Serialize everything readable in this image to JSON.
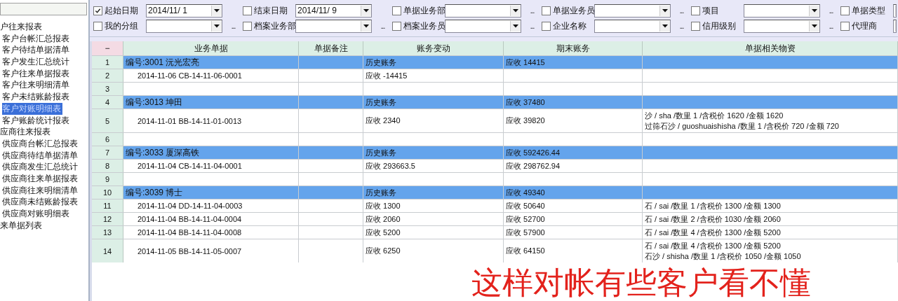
{
  "sidebar": {
    "items": [
      {
        "label": "户往来报表",
        "selected": false,
        "children": [
          {
            "label": "客户台帐汇总报表",
            "selected": false
          },
          {
            "label": "客户待结单据清单",
            "selected": false
          },
          {
            "label": "客户发生汇总统计",
            "selected": false
          },
          {
            "label": "客户往来单据报表",
            "selected": false
          },
          {
            "label": "客户往来明细清单",
            "selected": false
          },
          {
            "label": "客户未结账龄报表",
            "selected": false
          },
          {
            "label": "客户对账明细表",
            "selected": true
          },
          {
            "label": "客户账龄统计报表",
            "selected": false
          }
        ]
      },
      {
        "label": "应商往来报表",
        "selected": false,
        "children": [
          {
            "label": "供应商台帐汇总报表",
            "selected": false
          },
          {
            "label": "供应商待结单据清单",
            "selected": false
          },
          {
            "label": "供应商发生汇总统计",
            "selected": false
          },
          {
            "label": "供应商往来单据报表",
            "selected": false
          },
          {
            "label": "供应商往来明细清单",
            "selected": false
          },
          {
            "label": "供应商未结账龄报表",
            "selected": false
          },
          {
            "label": "供应商对账明细表",
            "selected": false
          }
        ]
      },
      {
        "label": "来单据列表",
        "selected": false
      }
    ]
  },
  "filter_rows": [
    {
      "filters": [
        {
          "label": "起始日期",
          "checked": true,
          "value": "2014/11/ 1"
        },
        {
          "label": "结束日期",
          "checked": false,
          "value": "2014/11/ 9"
        },
        {
          "label": "单据业务部",
          "checked": false,
          "more": "..."
        },
        {
          "label": "单据业务员",
          "checked": false,
          "more": "..."
        },
        {
          "label": "项目",
          "checked": false,
          "more": "..."
        },
        {
          "label": "单据类型",
          "checked": false
        }
      ]
    },
    {
      "filters": [
        {
          "label": "我的分组",
          "checked": false,
          "more": "..."
        },
        {
          "label": "档案业务部",
          "checked": false,
          "more": "..."
        },
        {
          "label": "档案业务员",
          "checked": false,
          "more": "..."
        },
        {
          "label": "企业名称",
          "checked": false,
          "more": "..."
        },
        {
          "label": "信用级别",
          "checked": false,
          "more": "..."
        },
        {
          "label": "代理商",
          "checked": false
        }
      ]
    }
  ],
  "table": {
    "corner": "−",
    "columns": [
      "业务单据",
      "单据备注",
      "账务变动",
      "期末账务",
      "单据相关物资"
    ],
    "rows": [
      {
        "number": "1",
        "kind": "group",
        "document": "编号:3001 沅光宏亮",
        "change": "历史账务",
        "balance": "应收 14415"
      },
      {
        "number": "2",
        "kind": "detail",
        "document": "2014-11-06 CB-14-11-06-0001",
        "change": "应收 -14415"
      },
      {
        "number": "3",
        "kind": "blank"
      },
      {
        "number": "4",
        "kind": "group",
        "document": "编号:3013 坤田",
        "change": "历史账务",
        "balance": "应收 37480"
      },
      {
        "number": "5",
        "kind": "detail",
        "document": "2014-11-01 BB-14-11-01-0013",
        "change": "应收 2340",
        "balance": "应收 39820",
        "materials": [
          "沙 / sha /数里 1 /含税价 1620 /金额 1620",
          "过筛石沙 / guoshuaishisha /数里 1 /含税价 720 /金额 720"
        ]
      },
      {
        "number": "6",
        "kind": "blank"
      },
      {
        "number": "7",
        "kind": "group",
        "document": "编号:3033 厦深高铁",
        "change": "历史账务",
        "balance": "应收 592426.44"
      },
      {
        "number": "8",
        "kind": "detail",
        "document": "2014-11-04 CB-14-11-04-0001",
        "change": "应收 293663.5",
        "balance": "应收 298762.94"
      },
      {
        "number": "9",
        "kind": "blank"
      },
      {
        "number": "10",
        "kind": "group",
        "document": "编号:3039 博士",
        "change": "历史账务",
        "balance": "应收 49340"
      },
      {
        "number": "11",
        "kind": "detail",
        "document": "2014-11-04 DD-14-11-04-0003",
        "change": "应收 1300",
        "balance": "应收 50640",
        "materials": [
          "石 / sai /数里 1 /含税价 1300 /金额 1300"
        ]
      },
      {
        "number": "12",
        "kind": "detail",
        "document": "2014-11-04 BB-14-11-04-0004",
        "change": "应收 2060",
        "balance": "应收 52700",
        "materials": [
          "石 / sai /数里 2 /含税价 1030 /金额 2060"
        ]
      },
      {
        "number": "13",
        "kind": "detail",
        "document": "2014-11-04 BB-14-11-04-0008",
        "change": "应收 5200",
        "balance": "应收 57900",
        "materials": [
          "石 / sai /数里 4 /含税价 1300 /金额 5200"
        ]
      },
      {
        "number": "14",
        "kind": "detail",
        "document": "2014-11-05 BB-14-11-05-0007",
        "change": "应收 6250",
        "balance": "应收 64150",
        "materials": [
          "石 / sai /数里 4 /含税价 1300 /金额 5200",
          "石沙 / shisha /数里 1 /含税价 1050 /金额 1050"
        ]
      }
    ]
  },
  "annotation": "这样对帐有些客户看不懂"
}
